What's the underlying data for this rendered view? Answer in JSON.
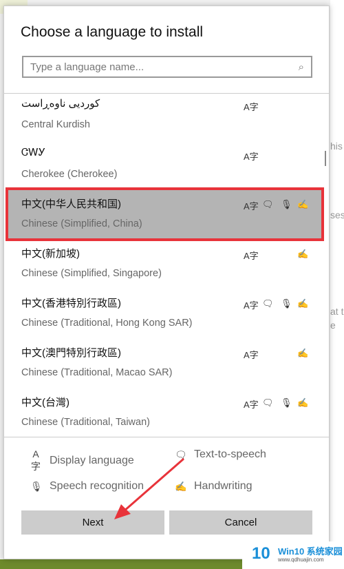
{
  "dialog": {
    "title": "Choose a language to install",
    "search_placeholder": "Type a language name...",
    "search_icon": "search-icon"
  },
  "languages": [
    {
      "name": "كوردیی ناوەڕاست",
      "sub": "Central Kurdish",
      "features": [
        "display"
      ]
    },
    {
      "name": "ᏣᎳᎩ",
      "sub": "Cherokee (Cherokee)",
      "features": [
        "display"
      ]
    },
    {
      "name": "中文(中华人民共和国)",
      "sub": "Chinese (Simplified, China)",
      "features": [
        "display",
        "tts",
        "speech",
        "handwriting"
      ],
      "selected": true
    },
    {
      "name": "中文(新加坡)",
      "sub": "Chinese (Simplified, Singapore)",
      "features": [
        "display",
        "handwriting"
      ]
    },
    {
      "name": "中文(香港特別行政區)",
      "sub": "Chinese (Traditional, Hong Kong SAR)",
      "features": [
        "display",
        "tts",
        "speech",
        "handwriting"
      ]
    },
    {
      "name": "中文(澳門特別行政區)",
      "sub": "Chinese (Traditional, Macao SAR)",
      "features": [
        "display",
        "handwriting"
      ]
    },
    {
      "name": "中文(台灣)",
      "sub": "Chinese (Traditional, Taiwan)",
      "features": [
        "display",
        "tts",
        "speech",
        "handwriting"
      ]
    }
  ],
  "legend": {
    "display": "Display language",
    "tts": "Text-to-speech",
    "speech": "Speech recognition",
    "handwriting": "Handwriting"
  },
  "buttons": {
    "next": "Next",
    "cancel": "Cancel"
  },
  "background_text": [
    "his",
    "ses",
    "at t",
    "e"
  ],
  "watermark": {
    "logo": "10",
    "title": "Win10 系统家园",
    "url": "www.qdhuajin.com"
  },
  "colors": {
    "highlight": "#b4b4b4",
    "annotation": "#e8333a"
  }
}
